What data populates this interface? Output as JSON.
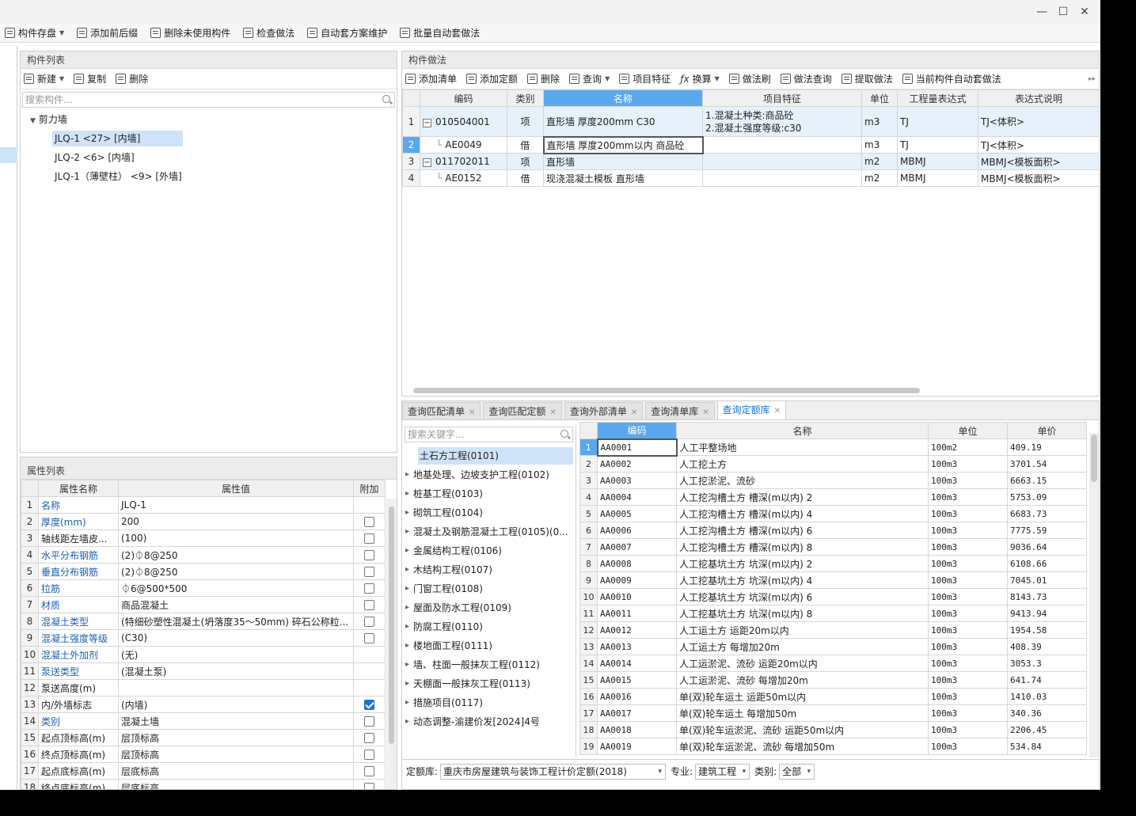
{
  "toolbar": {
    "items": [
      "构件存盘",
      "添加前后缀",
      "删除未使用构件",
      "检查做法",
      "自动套方案维护",
      "批量自动套做法"
    ]
  },
  "component_list": {
    "title": "构件列表",
    "new_label": "新建",
    "copy_label": "复制",
    "delete_label": "删除",
    "search_placeholder": "搜索构件...",
    "root": "剪力墙",
    "children": [
      "JLQ-1 <27> [内墙]",
      "JLQ-2 <6> [内墙]",
      "JLQ-1（薄壁柱） <9> [外墙]"
    ]
  },
  "properties": {
    "title": "属性列表",
    "headers": [
      "属性名称",
      "属性值",
      "附加"
    ],
    "rows": [
      {
        "n": "1",
        "name": "名称",
        "value": "JLQ-1",
        "cb": "none",
        "blue": true
      },
      {
        "n": "2",
        "name": "厚度(mm)",
        "value": "200",
        "cb": "off",
        "blue": true
      },
      {
        "n": "3",
        "name": "轴线距左墙皮...",
        "value": "(100)",
        "cb": "off",
        "blue": false
      },
      {
        "n": "4",
        "name": "水平分布钢筋",
        "value": "(2)⏀8@250",
        "cb": "off",
        "blue": true
      },
      {
        "n": "5",
        "name": "垂直分布钢筋",
        "value": "(2)⏀8@250",
        "cb": "off",
        "blue": true
      },
      {
        "n": "6",
        "name": "拉筋",
        "value": "⏀6@500*500",
        "cb": "off",
        "blue": true
      },
      {
        "n": "7",
        "name": "材质",
        "value": "商品混凝土",
        "cb": "off",
        "blue": true
      },
      {
        "n": "8",
        "name": "混凝土类型",
        "value": "(特细砂塑性混凝土(坍落度35～50mm) 碎石公称粒...",
        "cb": "off",
        "blue": true
      },
      {
        "n": "9",
        "name": "混凝土强度等级",
        "value": "(C30)",
        "cb": "off",
        "blue": true
      },
      {
        "n": "10",
        "name": "混凝土外加剂",
        "value": "(无)",
        "cb": "none",
        "blue": true
      },
      {
        "n": "11",
        "name": "泵送类型",
        "value": "(混凝土泵)",
        "cb": "none",
        "blue": true
      },
      {
        "n": "12",
        "name": "泵送高度(m)",
        "value": "",
        "cb": "none",
        "blue": false
      },
      {
        "n": "13",
        "name": "内/外墙标志",
        "value": "(内墙)",
        "cb": "on",
        "blue": false
      },
      {
        "n": "14",
        "name": "类别",
        "value": "混凝土墙",
        "cb": "off",
        "blue": true
      },
      {
        "n": "15",
        "name": "起点顶标高(m)",
        "value": "层顶标高",
        "cb": "off",
        "blue": false
      },
      {
        "n": "16",
        "name": "终点顶标高(m)",
        "value": "层顶标高",
        "cb": "off",
        "blue": false
      },
      {
        "n": "17",
        "name": "起点底标高(m)",
        "value": "层底标高",
        "cb": "off",
        "blue": false
      },
      {
        "n": "18",
        "name": "终点底标高(m)",
        "value": "层底标高",
        "cb": "off",
        "blue": false
      }
    ]
  },
  "method": {
    "title": "构件做法",
    "toolbar": [
      "添加清单",
      "添加定额",
      "删除",
      "查询",
      "项目特征",
      "换算",
      "做法刷",
      "做法查询",
      "提取做法",
      "当前构件自动套做法"
    ],
    "headers": [
      "编码",
      "类别",
      "名称",
      "项目特征",
      "单位",
      "工程量表达式",
      "表达式说明"
    ],
    "rows": [
      {
        "n": "1",
        "code": "010504001",
        "type": "项",
        "name": "直形墙 厚度200mm  C30",
        "feature1": "1.混凝土种类:商品砼",
        "feature2": "2.混凝土强度等级:c30",
        "unit": "m3",
        "expr": "TJ",
        "desc": "TJ<体积>"
      },
      {
        "n": "2",
        "code": "AE0049",
        "type": "借",
        "name": "直形墙 厚度200mm以内 商品砼",
        "feature1": "",
        "feature2": "",
        "unit": "m3",
        "expr": "TJ",
        "desc": "TJ<体积>"
      },
      {
        "n": "3",
        "code": "011702011",
        "type": "项",
        "name": "直形墙",
        "feature1": "",
        "feature2": "",
        "unit": "m2",
        "expr": "MBMJ",
        "desc": "MBMJ<模板面积>"
      },
      {
        "n": "4",
        "code": "AE0152",
        "type": "借",
        "name": "现浇混凝土模板 直形墙",
        "feature1": "",
        "feature2": "",
        "unit": "m2",
        "expr": "MBMJ",
        "desc": "MBMJ<模板面积>"
      }
    ]
  },
  "query": {
    "tabs": [
      "查询匹配清单",
      "查询匹配定额",
      "查询外部清单",
      "查询清单库",
      "查询定额库"
    ],
    "search_placeholder": "搜索关键字...",
    "categories": [
      "土石方工程(0101)",
      "地基处理、边坡支护工程(0102)",
      "桩基工程(0103)",
      "砌筑工程(0104)",
      "混凝土及钢筋混凝土工程(0105)(0...",
      "金属结构工程(0106)",
      "木结构工程(0107)",
      "门窗工程(0108)",
      "屋面及防水工程(0109)",
      "防腐工程(0110)",
      "楼地面工程(0111)",
      "墙、柱面一般抹灰工程(0112)",
      "天棚面一般抹灰工程(0113)",
      "措施项目(0117)",
      "动态调整-渝建价发[2024]4号"
    ],
    "headers": [
      "编码",
      "名称",
      "单位",
      "单价"
    ],
    "rows": [
      [
        "1",
        "AA0001",
        "人工平整场地",
        "100m2",
        "409.19"
      ],
      [
        "2",
        "AA0002",
        "人工挖土方",
        "100m3",
        "3701.54"
      ],
      [
        "3",
        "AA0003",
        "人工挖淤泥、流砂",
        "100m3",
        "6663.15"
      ],
      [
        "4",
        "AA0004",
        "人工挖沟槽土方 槽深(m以内) 2",
        "100m3",
        "5753.09"
      ],
      [
        "5",
        "AA0005",
        "人工挖沟槽土方 槽深(m以内) 4",
        "100m3",
        "6683.73"
      ],
      [
        "6",
        "AA0006",
        "人工挖沟槽土方 槽深(m以内) 6",
        "100m3",
        "7775.59"
      ],
      [
        "7",
        "AA0007",
        "人工挖沟槽土方 槽深(m以内) 8",
        "100m3",
        "9036.64"
      ],
      [
        "8",
        "AA0008",
        "人工挖基坑土方 坑深(m以内) 2",
        "100m3",
        "6108.66"
      ],
      [
        "9",
        "AA0009",
        "人工挖基坑土方 坑深(m以内) 4",
        "100m3",
        "7045.01"
      ],
      [
        "10",
        "AA0010",
        "人工挖基坑土方 坑深(m以内) 6",
        "100m3",
        "8143.73"
      ],
      [
        "11",
        "AA0011",
        "人工挖基坑土方 坑深(m以内) 8",
        "100m3",
        "9413.94"
      ],
      [
        "12",
        "AA0012",
        "人工运土方 运距20m以内",
        "100m3",
        "1954.58"
      ],
      [
        "13",
        "AA0013",
        "人工运土方 每增加20m",
        "100m3",
        "408.39"
      ],
      [
        "14",
        "AA0014",
        "人工运淤泥、流砂 运距20m以内",
        "100m3",
        "3053.3"
      ],
      [
        "15",
        "AA0015",
        "人工运淤泥、流砂 每增加20m",
        "100m3",
        "641.74"
      ],
      [
        "16",
        "AA0016",
        "单(双)轮车运土 运距50m以内",
        "100m3",
        "1410.03"
      ],
      [
        "17",
        "AA0017",
        "单(双)轮车运土 每增加50m",
        "100m3",
        "340.36"
      ],
      [
        "18",
        "AA0018",
        "单(双)轮车运淤泥、流砂 运距50m以内",
        "100m3",
        "2206.45"
      ],
      [
        "19",
        "AA0019",
        "单(双)轮车运淤泥、流砂 每增加50m",
        "100m3",
        "534.84"
      ]
    ],
    "footer": {
      "lib_label": "定额库:",
      "lib_value": "重庆市房屋建筑与装饰工程计价定额(2018)",
      "major_label": "专业:",
      "major_value": "建筑工程",
      "cat_label": "类别:",
      "cat_value": "全部"
    }
  },
  "colors": {
    "accent": "#5aa9ee",
    "selection": "#cfe3f8",
    "link": "#1a5fb4"
  }
}
